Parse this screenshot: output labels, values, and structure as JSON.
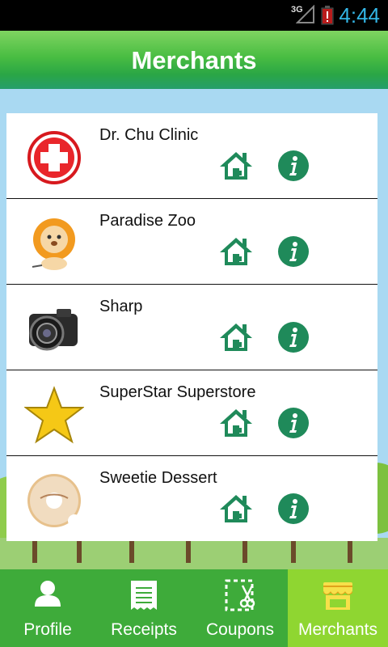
{
  "status_bar": {
    "network": "3G",
    "time": "4:44"
  },
  "header": {
    "title": "Merchants"
  },
  "merchants": [
    {
      "name": "Dr. Chu Clinic",
      "logo": "red-cross-icon"
    },
    {
      "name": "Paradise Zoo",
      "logo": "lion-icon"
    },
    {
      "name": "Sharp",
      "logo": "camera-icon"
    },
    {
      "name": "SuperStar Superstore",
      "logo": "star-icon"
    },
    {
      "name": "Sweetie Dessert",
      "logo": "donut-icon"
    }
  ],
  "row_actions": {
    "home_icon": "home-icon",
    "info_icon": "info-icon"
  },
  "nav": {
    "tabs": [
      {
        "label": "Profile",
        "icon": "person-icon"
      },
      {
        "label": "Receipts",
        "icon": "receipt-icon"
      },
      {
        "label": "Coupons",
        "icon": "scissors-coupon-icon"
      },
      {
        "label": "Merchants",
        "icon": "storefront-icon"
      }
    ],
    "active": "Merchants"
  },
  "colors": {
    "accent_green": "#2aa645",
    "icon_green": "#1f8a5a",
    "nav_green": "#3eab3a",
    "nav_active": "#8fd631",
    "sky": "#a9d9f2"
  }
}
